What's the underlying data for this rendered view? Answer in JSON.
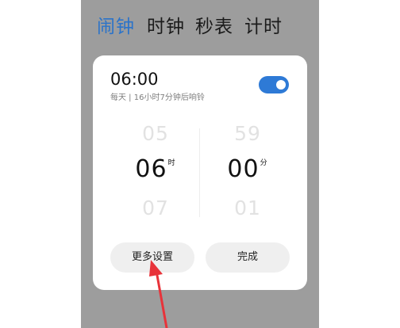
{
  "tabs": [
    {
      "label": "闹钟",
      "active": true
    },
    {
      "label": "时钟",
      "active": false
    },
    {
      "label": "秒表",
      "active": false
    },
    {
      "label": "计时",
      "active": false
    }
  ],
  "dialog": {
    "alarm_time": "06:00",
    "alarm_subtitle": "每天 | 16小时7分钟后响铃",
    "toggle_on": true,
    "hours": {
      "prev": "05",
      "current": "06",
      "next": "07",
      "unit": "时"
    },
    "minutes": {
      "prev": "59",
      "current": "00",
      "next": "01",
      "unit": "分"
    },
    "more_settings_label": "更多设置",
    "done_label": "完成"
  },
  "colors": {
    "accent": "#2b73c9",
    "toggle": "#2e7ad6",
    "backdrop": "#9d9d9d",
    "annotation_arrow": "#e8333a"
  }
}
